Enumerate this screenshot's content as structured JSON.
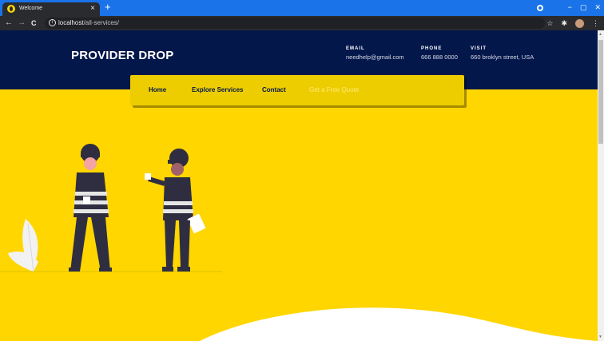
{
  "browser": {
    "tab_title": "Welcome",
    "tab_close": "×",
    "new_tab": "+",
    "url_host": "localhost",
    "url_path": "/all-services/",
    "back": "←",
    "forward": "→",
    "reload": "C",
    "window_controls": {
      "minimize": "−",
      "maximize": "▢",
      "close": "✕"
    },
    "toolbar_icons": {
      "star": "☆",
      "puzzle": "✱",
      "menu": "⋮"
    }
  },
  "site": {
    "brand": "PROVIDER DROP",
    "contacts": [
      {
        "label": "EMAIL",
        "value": "needhelp@gmail.com"
      },
      {
        "label": "PHONE",
        "value": "666 888 0000"
      },
      {
        "label": "VISIT",
        "value": "660 broklyn street, USA"
      }
    ],
    "nav": [
      {
        "label": "Home"
      },
      {
        "label": "Explore Services"
      },
      {
        "label": "Contact"
      },
      {
        "label": "Get a Free Quote"
      }
    ]
  },
  "colors": {
    "header_bg": "#03174a",
    "hero_bg": "#ffd600",
    "nav_bg": "#edcd00",
    "chrome_tabbar": "#1a73e8"
  },
  "icons": [
    "back-icon",
    "forward-icon",
    "reload-icon",
    "info-icon",
    "star-icon",
    "extensions-icon",
    "menu-icon"
  ]
}
